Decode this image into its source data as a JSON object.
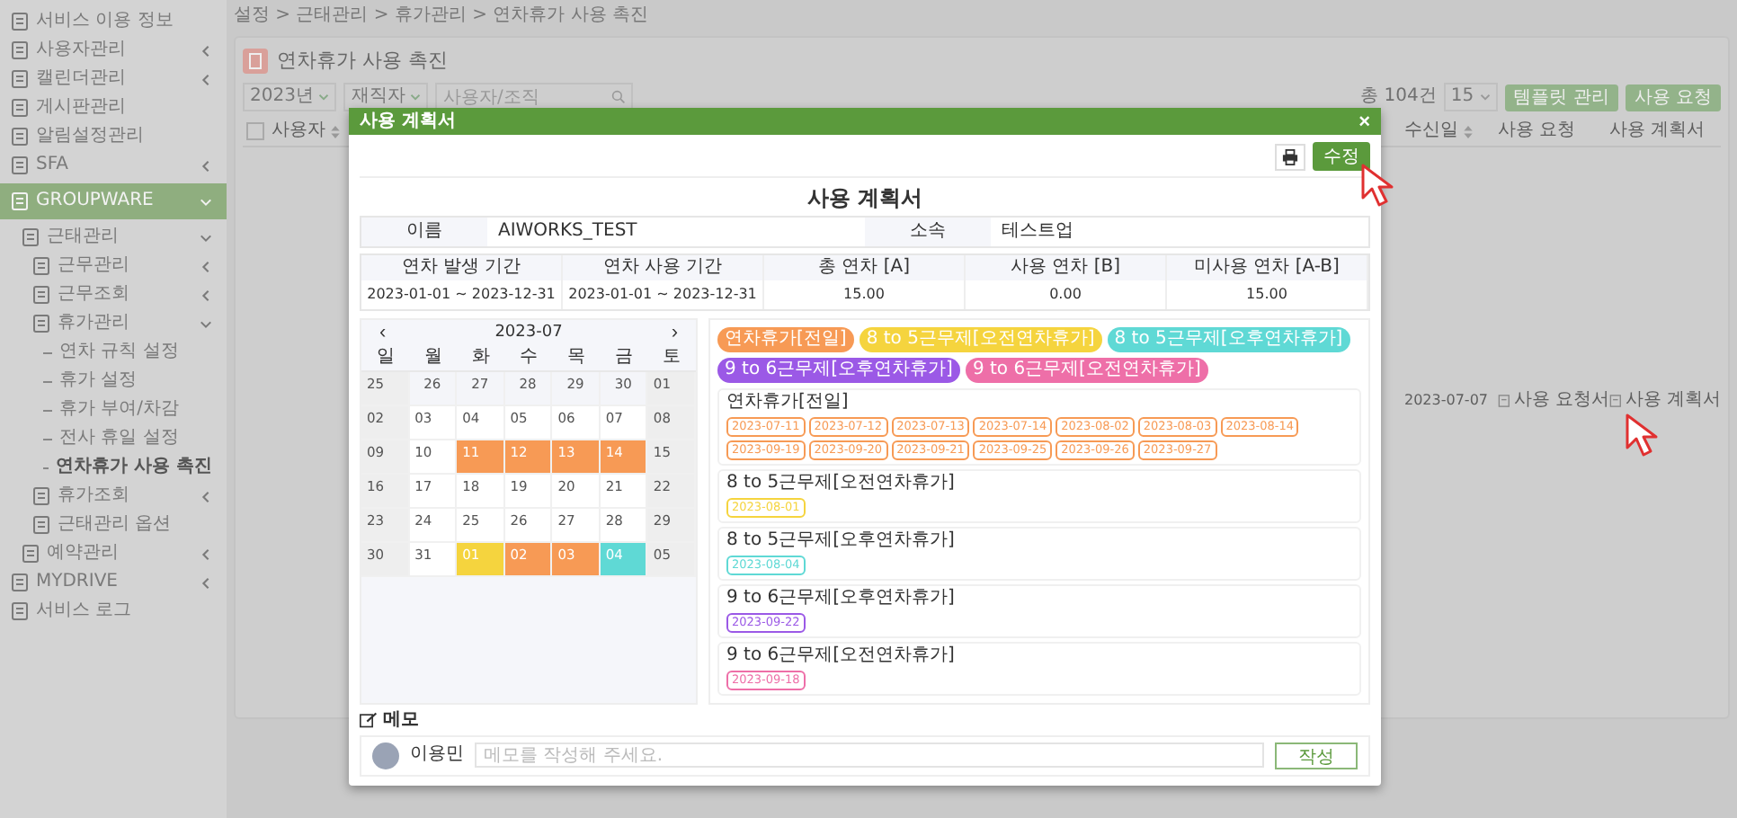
{
  "sidebar": {
    "items": [
      {
        "label": "서비스 이용 정보",
        "selected": false
      },
      {
        "label": "사용자관리",
        "selected": false,
        "expanded": false
      },
      {
        "label": "캘린더관리",
        "selected": false,
        "expanded": false
      },
      {
        "label": "게시판관리",
        "selected": false
      },
      {
        "label": "알림설정관리",
        "selected": false
      },
      {
        "label": "SFA",
        "selected": false,
        "expanded": false
      },
      {
        "label": "GROUPWARE",
        "selected": true,
        "expanded": true,
        "children": [
          {
            "label": "근태관리",
            "expanded": true,
            "children": [
              {
                "label": "근무관리",
                "expanded": false
              },
              {
                "label": "근무조회",
                "expanded": false
              },
              {
                "label": "휴가관리",
                "expanded": true,
                "children": [
                  {
                    "label": "연차 규칙 설정",
                    "selected": false
                  },
                  {
                    "label": "휴가 설정",
                    "selected": false
                  },
                  {
                    "label": "휴가 부여/차감",
                    "selected": false
                  },
                  {
                    "label": "전사 휴일 설정",
                    "selected": false
                  },
                  {
                    "label": "연차휴가 사용 촉진",
                    "selected": true
                  }
                ]
              },
              {
                "label": "휴가조회",
                "expanded": false
              },
              {
                "label": "근태관리 옵션"
              }
            ]
          },
          {
            "label": "예약관리",
            "expanded": false
          }
        ]
      },
      {
        "label": "MYDRIVE",
        "selected": false,
        "expanded": false
      },
      {
        "label": "서비스 로그",
        "selected": false
      }
    ]
  },
  "breadcrumb": "설정 > 근태관리 > 휴가관리 > 연차휴가 사용 촉진",
  "page": {
    "title": "연차휴가 사용 촉진",
    "filters": {
      "year": "2023년",
      "status": "재직자",
      "search_placeholder": "사용자/조직"
    },
    "total": "총 104건",
    "page_size": "15",
    "buttons": [
      "템플릿 관리",
      "사용 요청"
    ]
  },
  "table": {
    "header_checkbox": {
      "checked": false
    },
    "columns": [
      {
        "label": "사용자",
        "sortable": true
      },
      {
        "label": "수신일",
        "sortable": true
      },
      {
        "label": "사용 요청",
        "sortable": false
      },
      {
        "label": "사용 계획서",
        "sortable": false
      }
    ],
    "rows": [
      {
        "received": "2023-07-07",
        "request": "사용 요청서",
        "plan": "사용 계획서"
      }
    ]
  },
  "dialog": {
    "title": "사용 계획서",
    "close": "×",
    "edit_button": "수정",
    "heading": "사용 계획서",
    "info": [
      {
        "label": "이름",
        "value": "AIWORKS_TEST"
      },
      {
        "label": "소속",
        "value": "테스트업"
      }
    ],
    "summary": {
      "columns": [
        "연차 발생 기간",
        "연차 사용 기간",
        "총 연차 [A]",
        "사용 연차 [B]",
        "미사용 연차 [A-B]"
      ],
      "values": [
        "2023-01-01 ~ 2023-12-31",
        "2023-01-01 ~ 2023-12-31",
        "15.00",
        "0.00",
        "15.00"
      ]
    },
    "calendar": {
      "prev": "‹",
      "month": "2023-07",
      "next": "›",
      "weekdays": [
        "일",
        "월",
        "화",
        "수",
        "목",
        "금",
        "토"
      ],
      "weeks": [
        [
          {
            "day": "25",
            "shaded": false
          },
          {
            "day": "26",
            "shaded": true
          },
          {
            "day": "27",
            "shaded": true
          },
          {
            "day": "28",
            "shaded": true
          },
          {
            "day": "29",
            "shaded": true
          },
          {
            "day": "30",
            "shaded": true
          },
          {
            "day": "01",
            "shaded": false
          }
        ],
        [
          {
            "day": "02",
            "shaded": false
          },
          {
            "day": "03",
            "shaded": false
          },
          {
            "day": "04",
            "shaded": false
          },
          {
            "day": "05",
            "shaded": false
          },
          {
            "day": "06",
            "shaded": false
          },
          {
            "day": "07",
            "shaded": false
          },
          {
            "day": "08",
            "shaded": false
          }
        ],
        [
          {
            "day": "09",
            "shaded": false
          },
          {
            "day": "10",
            "shaded": false
          },
          {
            "day": "11",
            "shaded": false,
            "color": "#f79a55"
          },
          {
            "day": "12",
            "shaded": false,
            "color": "#f79a55"
          },
          {
            "day": "13",
            "shaded": false,
            "color": "#f79a55"
          },
          {
            "day": "14",
            "shaded": false,
            "color": "#f79a55"
          },
          {
            "day": "15",
            "shaded": false
          }
        ],
        [
          {
            "day": "16",
            "shaded": false
          },
          {
            "day": "17",
            "shaded": false
          },
          {
            "day": "18",
            "shaded": false
          },
          {
            "day": "19",
            "shaded": false
          },
          {
            "day": "20",
            "shaded": false
          },
          {
            "day": "21",
            "shaded": false
          },
          {
            "day": "22",
            "shaded": false
          }
        ],
        [
          {
            "day": "23",
            "shaded": false
          },
          {
            "day": "24",
            "shaded": false
          },
          {
            "day": "25",
            "shaded": false
          },
          {
            "day": "26",
            "shaded": false
          },
          {
            "day": "27",
            "shaded": false
          },
          {
            "day": "28",
            "shaded": false
          },
          {
            "day": "29",
            "shaded": false
          }
        ],
        [
          {
            "day": "30",
            "shaded": false
          },
          {
            "day": "31",
            "shaded": false
          },
          {
            "day": "01",
            "shaded": false,
            "color": "#f5d43e"
          },
          {
            "day": "02",
            "shaded": false,
            "color": "#f79a55"
          },
          {
            "day": "03",
            "shaded": false,
            "color": "#f79a55"
          },
          {
            "day": "04",
            "shaded": false,
            "color": "#5fd9d5"
          },
          {
            "day": "05",
            "shaded": false
          }
        ]
      ]
    },
    "legend": [
      {
        "kind": "full",
        "label": "연차휴가[전일]",
        "color": "#f79a55"
      },
      {
        "kind": "am8",
        "label": "8 to 5근무제[오전연차휴가]",
        "color": "#f5d43e"
      },
      {
        "kind": "pm8",
        "label": "8 to 5근무제[오후연차휴가]",
        "color": "#5fd9d5"
      },
      {
        "kind": "pm9",
        "label": "9 to 6근무제[오후연차휴가]",
        "color": "#9b59e6"
      },
      {
        "kind": "am9",
        "label": "9 to 6근무제[오전연차휴가]",
        "color": "#ee6fa8"
      }
    ],
    "groups": [
      {
        "kind": "full",
        "title": "연차휴가[전일]",
        "dates": [
          "2023-07-11",
          "2023-07-12",
          "2023-07-13",
          "2023-07-14",
          "2023-08-02",
          "2023-08-03",
          "2023-08-14",
          "2023-09-19",
          "2023-09-20",
          "2023-09-21",
          "2023-09-25",
          "2023-09-26",
          "2023-09-27"
        ]
      },
      {
        "kind": "am8",
        "title": "8 to 5근무제[오전연차휴가]",
        "dates": [
          "2023-08-01"
        ]
      },
      {
        "kind": "pm8",
        "title": "8 to 5근무제[오후연차휴가]",
        "dates": [
          "2023-08-04"
        ]
      },
      {
        "kind": "pm9",
        "title": "9 to 6근무제[오후연차휴가]",
        "dates": [
          "2023-09-22"
        ]
      },
      {
        "kind": "am9",
        "title": "9 to 6근무제[오전연차휴가]",
        "dates": [
          "2023-09-18"
        ]
      }
    ],
    "memo": {
      "title": "메모",
      "author": "이용민",
      "placeholder": "메모를 작성해 주세요.",
      "button": "작성"
    }
  }
}
